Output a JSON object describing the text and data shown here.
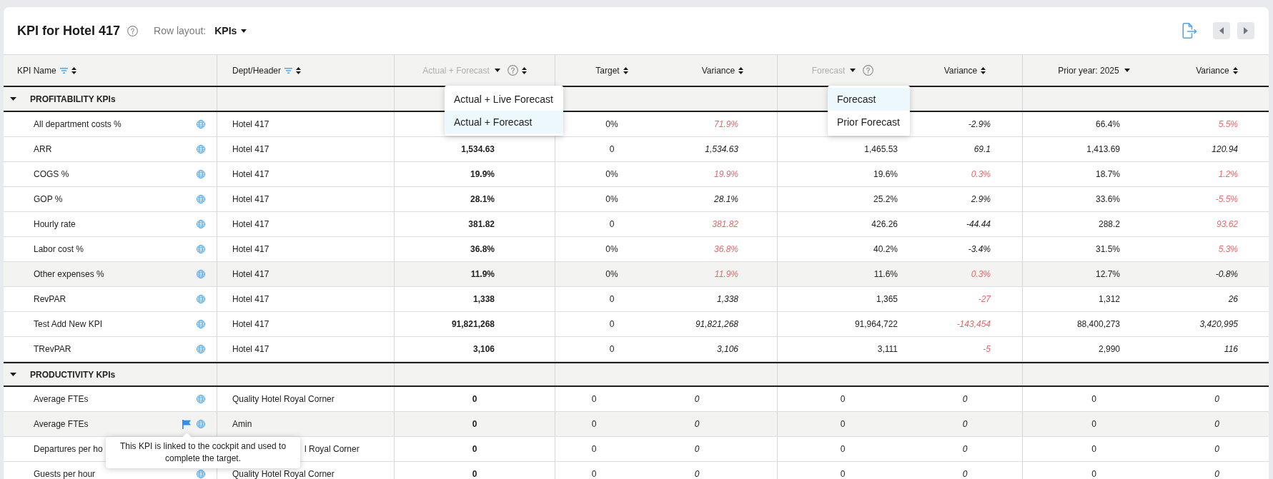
{
  "title": "KPI for Hotel 417",
  "row_layout": {
    "label": "Row layout:",
    "value": "KPIs"
  },
  "table": {
    "columns": [
      {
        "kind": "text",
        "label": "KPI Name",
        "filterable": true,
        "sortable": true
      },
      {
        "kind": "text",
        "label": "Dept/Header",
        "filterable": true,
        "sortable": true
      },
      {
        "kind": "dropdown",
        "label": "Actual + Forecast",
        "open": true,
        "help": true,
        "sortable": true,
        "menu": [
          {
            "label": "Actual + Live Forecast",
            "selected": false
          },
          {
            "label": "Actual + Forecast",
            "selected": true
          }
        ]
      },
      {
        "kind": "text",
        "label": "Target",
        "filterable": false,
        "sortable": true
      },
      {
        "kind": "text",
        "label": "Variance",
        "filterable": false,
        "sortable": true
      },
      {
        "kind": "dropdown",
        "label": "Forecast",
        "open": true,
        "help": true,
        "sortable": false,
        "menu": [
          {
            "label": "Forecast",
            "selected": true
          },
          {
            "label": "Prior Forecast",
            "selected": false
          }
        ]
      },
      {
        "kind": "text",
        "label": "Variance",
        "filterable": false,
        "sortable": true
      },
      {
        "kind": "dropdown",
        "label": "Prior year: 2025",
        "open": false,
        "help": false,
        "sortable": false
      },
      {
        "kind": "text",
        "label": "Variance",
        "filterable": false,
        "sortable": true
      }
    ],
    "sections": [
      {
        "label": "PROFITABILITY KPIs",
        "expanded": true,
        "rows": [
          {
            "name": "All department costs %",
            "dept": "Hotel 417",
            "linked": false,
            "highlighted": false,
            "target": "0%",
            "prior": "66.4%",
            "variances": [
              {
                "text": "71.9%",
                "unfavorable": true
              },
              {
                "text": "-2.9%",
                "unfavorable": false
              },
              {
                "text": "5.5%",
                "unfavorable": true
              }
            ]
          },
          {
            "name": "ARR",
            "dept": "Hotel 417",
            "linked": false,
            "highlighted": false,
            "actual": "1,534.63",
            "target": "0",
            "forecast": "1,465.53",
            "prior": "1,413.69",
            "variances": [
              {
                "text": "1,534.63",
                "unfavorable": false
              },
              {
                "text": "69.1",
                "unfavorable": false
              },
              {
                "text": "120.94",
                "unfavorable": false
              }
            ]
          },
          {
            "name": "COGS %",
            "dept": "Hotel 417",
            "linked": false,
            "highlighted": false,
            "actual": "19.9%",
            "target": "0%",
            "forecast": "19.6%",
            "prior": "18.7%",
            "variances": [
              {
                "text": "19.9%",
                "unfavorable": true
              },
              {
                "text": "0.3%",
                "unfavorable": true
              },
              {
                "text": "1.2%",
                "unfavorable": true
              }
            ]
          },
          {
            "name": "GOP %",
            "dept": "Hotel 417",
            "linked": false,
            "highlighted": false,
            "actual": "28.1%",
            "target": "0%",
            "forecast": "25.2%",
            "prior": "33.6%",
            "variances": [
              {
                "text": "28.1%",
                "unfavorable": false
              },
              {
                "text": "2.9%",
                "unfavorable": false
              },
              {
                "text": "-5.5%",
                "unfavorable": true
              }
            ]
          },
          {
            "name": "Hourly rate",
            "dept": "Hotel 417",
            "linked": false,
            "highlighted": false,
            "actual": "381.82",
            "target": "0",
            "forecast": "426.26",
            "prior": "288.2",
            "variances": [
              {
                "text": "381.82",
                "unfavorable": true
              },
              {
                "text": "-44.44",
                "unfavorable": false
              },
              {
                "text": "93.62",
                "unfavorable": true
              }
            ]
          },
          {
            "name": "Labor cost %",
            "dept": "Hotel 417",
            "linked": false,
            "highlighted": false,
            "actual": "36.8%",
            "target": "0%",
            "forecast": "40.2%",
            "prior": "31.5%",
            "variances": [
              {
                "text": "36.8%",
                "unfavorable": true
              },
              {
                "text": "-3.4%",
                "unfavorable": false
              },
              {
                "text": "5.3%",
                "unfavorable": true
              }
            ]
          },
          {
            "name": "Other expenses %",
            "dept": "Hotel 417",
            "linked": false,
            "highlighted": true,
            "actual": "11.9%",
            "target": "0%",
            "forecast": "11.6%",
            "prior": "12.7%",
            "variances": [
              {
                "text": "11.9%",
                "unfavorable": true
              },
              {
                "text": "0.3%",
                "unfavorable": true
              },
              {
                "text": "-0.8%",
                "unfavorable": false
              }
            ]
          },
          {
            "name": "RevPAR",
            "dept": "Hotel 417",
            "linked": false,
            "highlighted": false,
            "actual": "1,338",
            "target": "0",
            "forecast": "1,365",
            "prior": "1,312",
            "variances": [
              {
                "text": "1,338",
                "unfavorable": false
              },
              {
                "text": "-27",
                "unfavorable": true
              },
              {
                "text": "26",
                "unfavorable": false
              }
            ]
          },
          {
            "name": "Test Add New KPI",
            "dept": "Hotel 417",
            "linked": false,
            "highlighted": false,
            "actual": "91,821,268",
            "target": "0",
            "forecast": "91,964,722",
            "prior": "88,400,273",
            "variances": [
              {
                "text": "91,821,268",
                "unfavorable": false
              },
              {
                "text": "-143,454",
                "unfavorable": true
              },
              {
                "text": "3,420,995",
                "unfavorable": false
              }
            ]
          },
          {
            "name": "TRevPAR",
            "dept": "Hotel 417",
            "linked": false,
            "highlighted": false,
            "actual": "3,106",
            "target": "0",
            "forecast": "3,111",
            "prior": "2,990",
            "variances": [
              {
                "text": "3,106",
                "unfavorable": false
              },
              {
                "text": "-5",
                "unfavorable": true
              },
              {
                "text": "116",
                "unfavorable": false
              }
            ]
          }
        ]
      },
      {
        "label": "PRODUCTIVITY KPIs",
        "expanded": true,
        "rows": [
          {
            "name": "Average FTEs",
            "dept": "Quality Hotel Royal Corner",
            "linked": false,
            "highlighted": false,
            "actual": "0",
            "target": "0",
            "forecast": "0",
            "prior": "0",
            "variances": [
              {
                "text": "0",
                "unfavorable": false
              },
              {
                "text": "0",
                "unfavorable": false
              },
              {
                "text": "0",
                "unfavorable": false
              }
            ]
          },
          {
            "name": "Average FTEs",
            "dept": "Amin",
            "linked": true,
            "highlighted": true,
            "tooltip": "This KPI is linked to the cockpit and used to complete the target.",
            "actual": "0",
            "target": "0",
            "forecast": "0",
            "prior": "0",
            "variances": [
              {
                "text": "0",
                "unfavorable": false
              },
              {
                "text": "0",
                "unfavorable": false
              },
              {
                "text": "0",
                "unfavorable": false
              }
            ]
          },
          {
            "name": "Departures per ho",
            "dept": "l Royal Corner",
            "linked": false,
            "highlighted": false,
            "actual": "0",
            "target": "0",
            "forecast": "0",
            "prior": "0",
            "variances": [
              {
                "text": "0",
                "unfavorable": false
              },
              {
                "text": "0",
                "unfavorable": false
              },
              {
                "text": "0",
                "unfavorable": false
              }
            ]
          },
          {
            "name": "Guests per hour",
            "dept": "Quality Hotel Royal Corner",
            "linked": false,
            "highlighted": false,
            "actual": "0",
            "target": "0",
            "forecast": "0",
            "prior": "0",
            "variances": [
              {
                "text": "0",
                "unfavorable": false
              },
              {
                "text": "0",
                "unfavorable": false
              },
              {
                "text": "0",
                "unfavorable": false
              }
            ]
          }
        ]
      }
    ]
  }
}
